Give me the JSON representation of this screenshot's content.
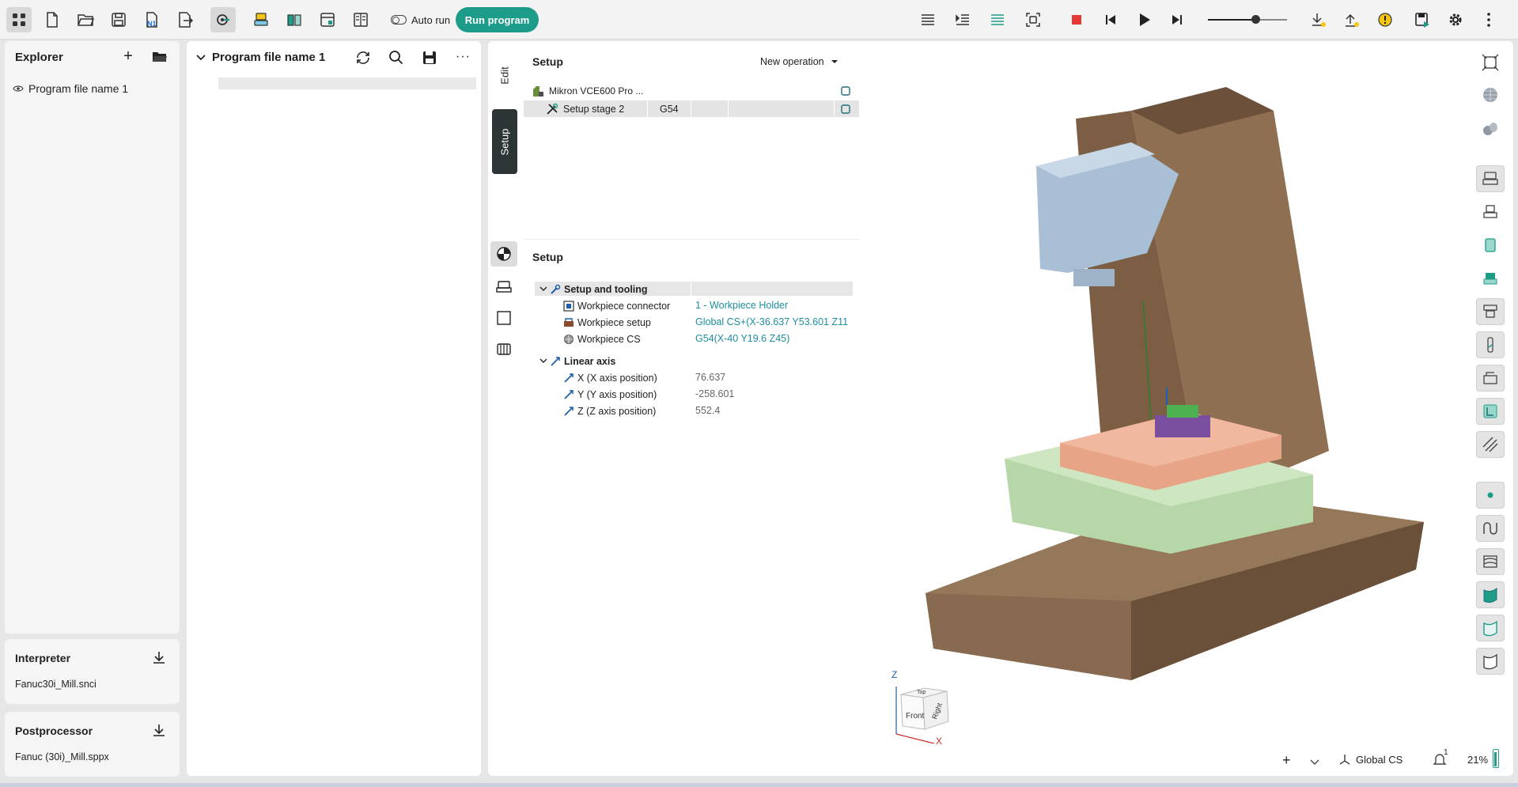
{
  "toolbar": {
    "auto_run_label": "Auto run",
    "run_program_label": "Run program",
    "speed_value": 0.6,
    "icons": [
      "app-grid-icon",
      "new-file-icon",
      "open-folder-icon",
      "save-icon",
      "save-as-icon",
      "nc-number-icon",
      "export-icon",
      "connect-icon",
      "machine-icon",
      "tools-icon",
      "simulation-window-icon",
      "columns-icon",
      "list-icon",
      "indent-icon",
      "align-icon",
      "screenshot-icon",
      "stop-icon",
      "skip-back-icon",
      "play-icon",
      "skip-forward-icon",
      "download-warning-icon",
      "upload-warning-icon",
      "alert-icon",
      "save-program-icon",
      "settings-icon",
      "more-vertical-icon"
    ]
  },
  "explorer": {
    "title": "Explorer",
    "items": [
      {
        "label": "Program file name 1"
      }
    ]
  },
  "interpreter": {
    "title": "Interpreter",
    "value": "Fanuc30i_Mill.snci"
  },
  "postprocessor": {
    "title": "Postprocessor",
    "value": "Fanuc (30i)_Mill.sppx"
  },
  "editor": {
    "title": "Program file name 1"
  },
  "vertical_tabs": {
    "edit": "Edit",
    "setup": "Setup"
  },
  "setup_top": {
    "title": "Setup",
    "new_operation_label": "New operation",
    "rows": [
      {
        "name": "Mikron VCE600 Pro ...",
        "cs": ""
      },
      {
        "name": "Setup stage 2",
        "cs": "G54"
      }
    ]
  },
  "setup_props": {
    "title": "Setup",
    "group1": {
      "label": "Setup and tooling",
      "items": [
        {
          "label": "Workpiece connector",
          "value": "1 - Workpiece Holder"
        },
        {
          "label": "Workpiece setup",
          "value": "Global CS+(X-36.637 Y53.601 Z11"
        },
        {
          "label": "Workpiece CS",
          "value": "G54(X-40 Y19.6 Z45)"
        }
      ]
    },
    "group2": {
      "label": "Linear axis",
      "items": [
        {
          "label": "X (X axis position)",
          "value": "76.637"
        },
        {
          "label": "Y (Y axis position)",
          "value": "-258.601"
        },
        {
          "label": "Z (Z axis position)",
          "value": "552.4"
        }
      ]
    }
  },
  "viewcube": {
    "front": "Front",
    "right": "Right",
    "top": "Top",
    "axis_z": "Z",
    "axis_x": "X"
  },
  "statusbar": {
    "cs_label": "Global CS",
    "notifications": "1",
    "zoom": "21%"
  },
  "colors": {
    "accent": "#1e9c8a",
    "link": "#1e8f9e",
    "stop": "#e53935",
    "warning": "#f5c518"
  }
}
